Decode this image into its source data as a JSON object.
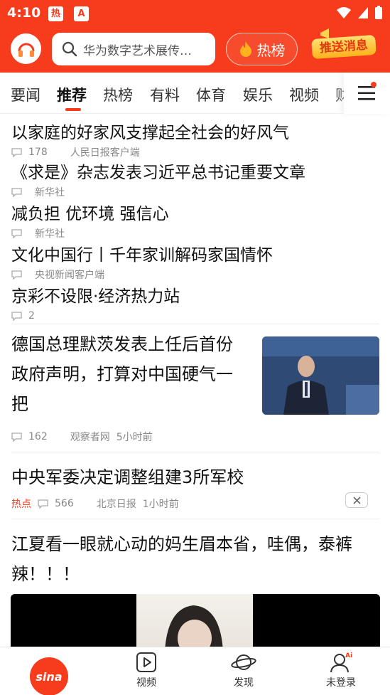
{
  "status_bar": {
    "time": "4:10",
    "badge_hot": "热",
    "badge_app": "A"
  },
  "header": {
    "search_placeholder": "华为数字艺术展传…",
    "hot_button_label": "热榜",
    "push_button_label": "推送消息"
  },
  "tabs": {
    "items": [
      "要闻",
      "推荐",
      "热榜",
      "有料",
      "体育",
      "娱乐",
      "视频",
      "财"
    ],
    "active": "推荐"
  },
  "feed": {
    "small_items": [
      {
        "title": "以家庭的好家风支撑起全社会的好风气",
        "comments": "178",
        "source": "人民日报客户端"
      },
      {
        "title": "《求是》杂志发表习近平总书记重要文章",
        "comments": "",
        "source": "新华社"
      },
      {
        "title": "减负担 优环境 强信心",
        "comments": "",
        "source": "新华社"
      },
      {
        "title": "文化中国行丨千年家训解码家国情怀",
        "comments": "",
        "source": "央视新闻客户端"
      },
      {
        "title": "京彩不设限·经济热力站",
        "comments": "2",
        "source": ""
      }
    ],
    "article1": {
      "title_lines": [
        "德国总理默茨发表上任后首份",
        "政府声明，打算对中国硬气一",
        "把"
      ],
      "comments": "162",
      "source": "观察者网",
      "time": "5小时前"
    },
    "article2": {
      "title": "中央军委决定调整组建3所军校",
      "tag": "热点",
      "comments": "566",
      "source": "北京日报",
      "time": "1小时前"
    },
    "article3": {
      "title_lines": [
        "江夏看一眼就心动的妈生眉本省，哇偶，泰裤",
        "辣！！！"
      ]
    }
  },
  "bottom_nav": {
    "home_logo": "sina",
    "items": [
      "视频",
      "发现",
      "未登录"
    ]
  },
  "colors": {
    "brand": "#f73c1d",
    "text": "#111111",
    "meta": "#888888"
  }
}
